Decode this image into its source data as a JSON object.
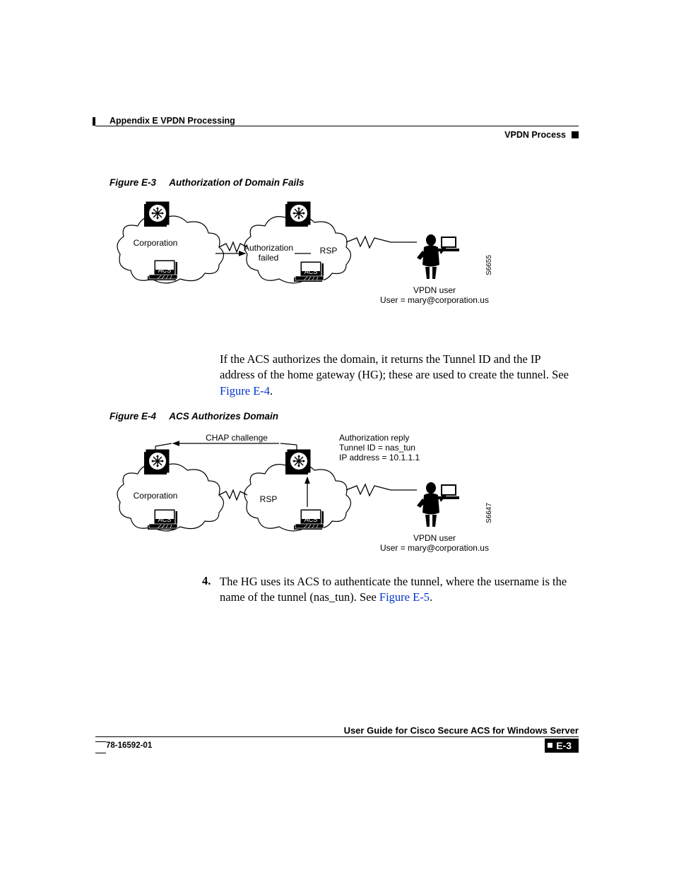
{
  "header": {
    "appendix": "Appendix E      VPDN Processing",
    "section": "VPDN Process"
  },
  "figures": {
    "e3": {
      "label": "Figure E-3",
      "title": "Authorization of Domain Fails",
      "corporation": "Corporation",
      "acs1": "ACS",
      "auth_text1": "Authorization",
      "auth_text2": "failed",
      "rsp": "RSP",
      "acs2": "ACS",
      "vpdn_user": "VPDN user",
      "user_line": "User = mary@corporation.us",
      "diagram_id": "S6655"
    },
    "e4": {
      "label": "Figure E-4",
      "title": "ACS Authorizes Domain",
      "chap": "CHAP challenge",
      "reply1": "Authorization reply",
      "reply2": "Tunnel ID = nas_tun",
      "reply3": "IP address = 10.1.1.1",
      "corporation": "Corporation",
      "acs1": "ACS",
      "rsp": "RSP",
      "acs2": "ACS",
      "vpdn_user": "VPDN user",
      "user_line": "User = mary@corporation.us",
      "diagram_id": "S6647"
    }
  },
  "paragraphs": {
    "p1a": "If the ACS authorizes the domain, it returns the Tunnel ID and the IP address of the home gateway (HG); these are used to create the tunnel. See ",
    "p1link": "Figure E-4",
    "p1b": ".",
    "step4_num": "4.",
    "p2a": "The HG uses its ACS to authenticate the tunnel, where the username is the name of the tunnel (nas_tun). See ",
    "p2link": "Figure E-5",
    "p2b": "."
  },
  "footer": {
    "guide": "User Guide for Cisco Secure ACS for Windows Server",
    "docnum": "78-16592-01",
    "pagenum": "E-3"
  }
}
